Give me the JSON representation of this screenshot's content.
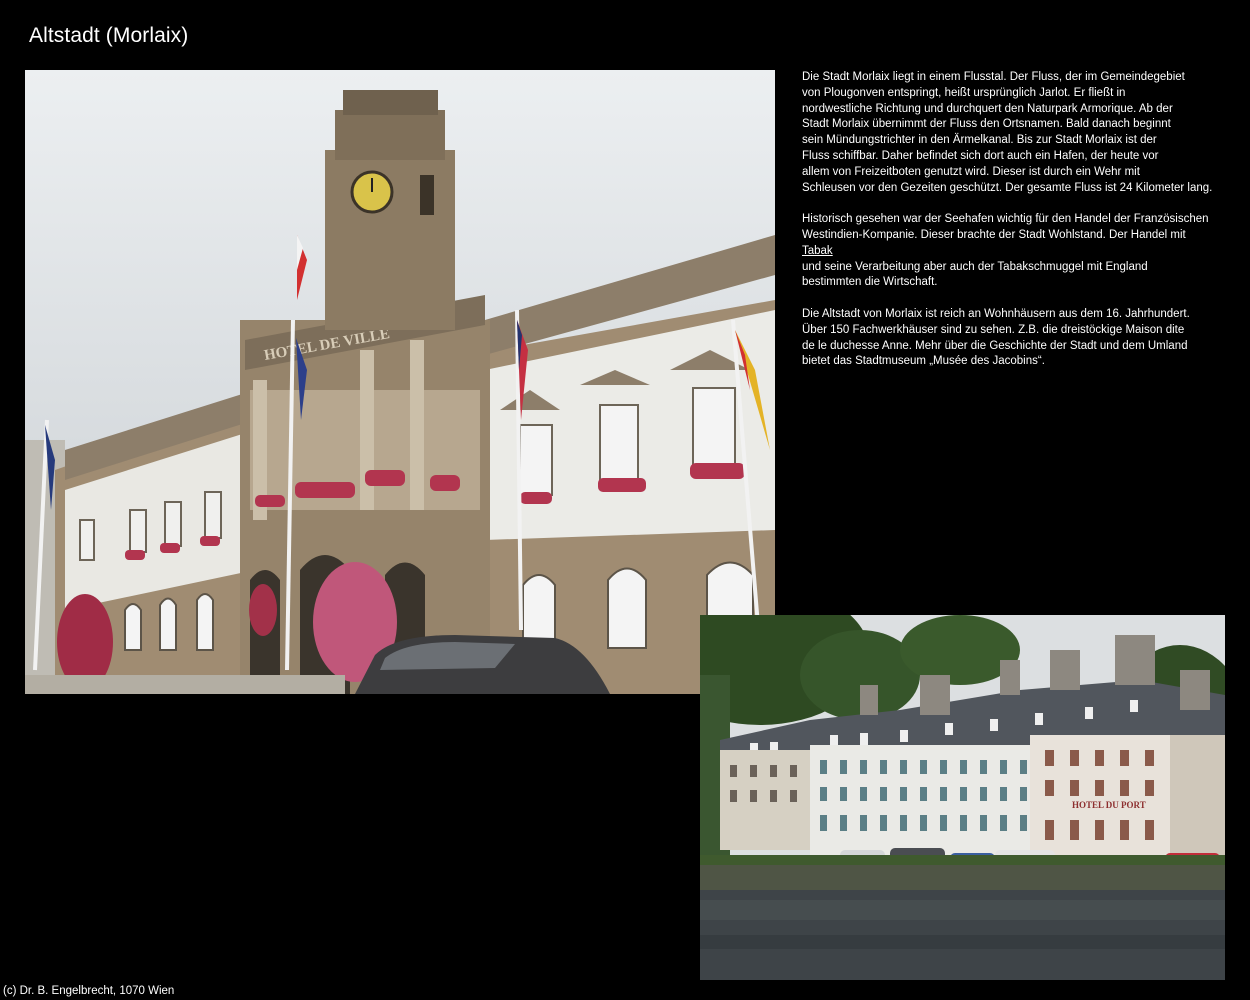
{
  "page": {
    "title": "Altstadt (Morlaix)",
    "copyright": "(c) Dr. B. Engelbrecht, 1070 Wien"
  },
  "photos": {
    "town_hall": {
      "sign": "HOTEL DE VILLE"
    },
    "harbour": {
      "sign": "HOTEL DU PORT"
    }
  },
  "text": {
    "p1": [
      "Die Stadt Morlaix liegt in einem Flusstal. Der Fluss, der im Gemeindegebiet",
      "von Plougonven entspringt, heißt ursprünglich Jarlot. Er fließt in",
      "nordwestliche Richtung und durchquert den Naturpark Armorique. Ab der",
      "Stadt Morlaix übernimmt der Fluss den Ortsnamen. Bald danach beginnt",
      "sein Mündungstrichter in den Ärmelkanal. Bis zur Stadt Morlaix ist der",
      "Fluss schiffbar. Daher befindet sich dort auch ein Hafen, der heute vor",
      "allem von Freizeitboten genutzt wird. Dieser ist durch ein Wehr mit",
      "Schleusen vor den Gezeiten geschützt. Der gesamte Fluss ist 24 Kilometer lang."
    ],
    "p2": {
      "line1": "Historisch gesehen war der Seehafen wichtig für den Handel der Französischen",
      "line2": "Westindien-Kompanie. Dieser brachte der Stadt Wohlstand. Der Handel mit",
      "link": "Tabak",
      "line3": "und seine Verarbeitung aber auch der Tabakschmuggel mit England",
      "line4": "bestimmten die Wirtschaft."
    },
    "p3": [
      "Die Altstadt von Morlaix ist reich an Wohnhäusern aus dem 16. Jahrhundert.",
      "Über 150 Fachwerkhäuser sind zu sehen. Z.B. die dreistöckige Maison dite",
      "de le duchesse Anne. Mehr über die Geschichte der Stadt und dem Umland",
      "bietet das Stadtmuseum „Musée des Jacobins“."
    ]
  },
  "colors": {
    "background": "#000000",
    "text": "#ffffff",
    "sky": "#d9dde0",
    "stone": "#9c8a72",
    "facade": "#e6e6e2",
    "roof": "#55595f",
    "water": "#3d4347",
    "foliage": "#2f4a22"
  }
}
